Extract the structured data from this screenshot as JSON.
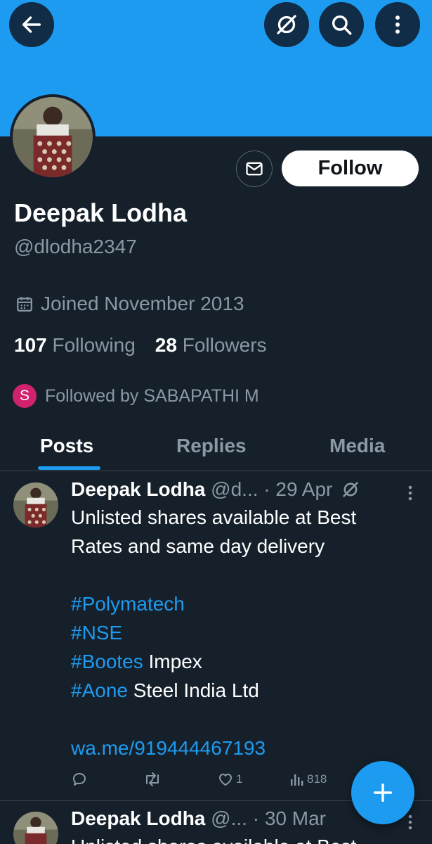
{
  "profile": {
    "name": "Deepak Lodha",
    "handle": "@dlodha2347",
    "joined": "Joined November 2013",
    "following_count": "107",
    "following_label": "Following",
    "followers_count": "28",
    "followers_label": "Followers",
    "followed_by_initial": "S",
    "followed_by": "Followed by SABAPATHI M",
    "follow_label": "Follow"
  },
  "tabs": [
    {
      "label": "Posts",
      "active": true
    },
    {
      "label": "Replies",
      "active": false
    },
    {
      "label": "Media",
      "active": false
    }
  ],
  "posts": [
    {
      "name": "Deepak Lodha",
      "handle": "@d...",
      "date": "· 29 Apr",
      "line1": "Unlisted shares available at Best",
      "line2": "Rates and same day delivery",
      "tags": [
        {
          "tag": "#Polymatech",
          "rest": ""
        },
        {
          "tag": "#NSE",
          "rest": ""
        },
        {
          "tag": "#Bootes",
          "rest": " Impex"
        },
        {
          "tag": "#Aone",
          "rest": " Steel India Ltd"
        }
      ],
      "link": "wa.me/919444467193",
      "likes": "1",
      "views": "818"
    },
    {
      "name": "Deepak Lodha",
      "handle": "@...",
      "date": "· 30 Mar",
      "line1": "Unlisted shares available at Best"
    }
  ],
  "icons": {
    "back": "arrow-left-icon",
    "grok": "grok-icon",
    "search": "search-icon",
    "more": "more-vertical-icon",
    "message": "envelope-icon",
    "calendar": "calendar-icon",
    "reply": "reply-icon",
    "repost": "repost-icon",
    "like": "heart-icon",
    "views": "views-icon",
    "compose": "plus-icon"
  },
  "colors": {
    "background": "#15202b",
    "banner": "#1d9bf0",
    "accent": "#1d9bf0",
    "muted_text": "#8b98a5",
    "badge": "#d0226e"
  }
}
